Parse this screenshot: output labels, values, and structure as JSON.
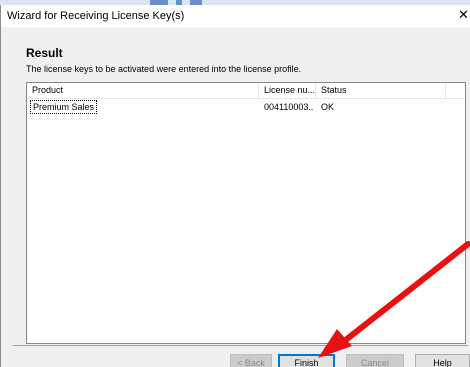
{
  "window": {
    "title": "Wizard for Receiving License Key(s)",
    "close_glyph": "✕"
  },
  "page": {
    "heading": "Result",
    "description": "The license keys to be activated were entered into the license profile."
  },
  "table": {
    "columns": [
      "Product",
      "License nu...",
      "Status"
    ],
    "rows": [
      {
        "product": "Premium Sales",
        "license": "004110003...",
        "status": "OK"
      }
    ]
  },
  "buttons": {
    "back": "< Back",
    "finish": "Finish",
    "cancel": "Cancel",
    "help": "Help"
  },
  "colors": {
    "annotation_arrow": "#e81010",
    "default_button_border": "#0078d7"
  }
}
